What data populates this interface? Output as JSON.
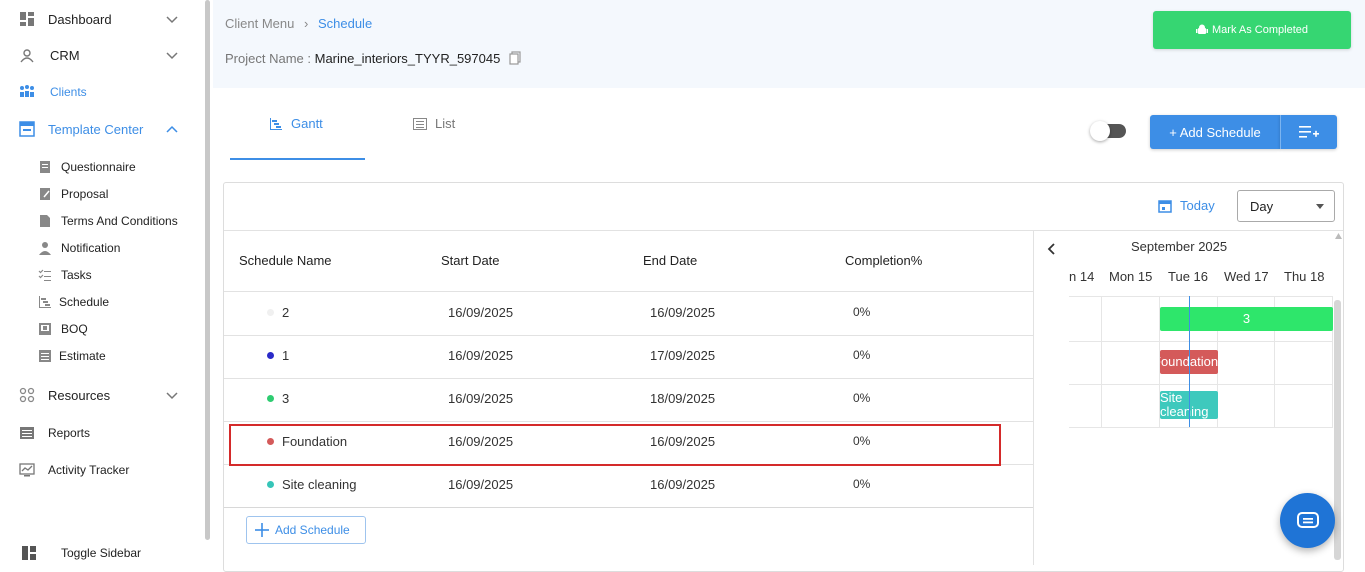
{
  "sidebar": {
    "items": [
      {
        "label": "Dashboard"
      },
      {
        "label": "CRM"
      },
      {
        "label": "Clients"
      },
      {
        "label": "Template Center"
      },
      {
        "label": "Resources"
      },
      {
        "label": "Reports"
      },
      {
        "label": "Activity Tracker"
      }
    ],
    "sub_items": [
      {
        "label": "Questionnaire"
      },
      {
        "label": "Proposal"
      },
      {
        "label": "Terms And Conditions"
      },
      {
        "label": "Notification"
      },
      {
        "label": "Tasks"
      },
      {
        "label": "Schedule"
      },
      {
        "label": "BOQ"
      },
      {
        "label": "Estimate"
      }
    ],
    "toggle_label": "Toggle Sidebar"
  },
  "header": {
    "breadcrumb": {
      "parent": "Client Menu",
      "current": "Schedule"
    },
    "project_label": "Project Name :",
    "project_name": "Marine_interiors_TYYR_597045",
    "mark_completed": "Mark As Completed"
  },
  "tabs": [
    {
      "label": "Gantt"
    },
    {
      "label": "List"
    }
  ],
  "toolbar": {
    "add_schedule": "+ Add Schedule",
    "today": "Today",
    "view_select": "Day"
  },
  "table": {
    "columns": [
      "Schedule Name",
      "Start Date",
      "End Date",
      "Completion%"
    ],
    "rows": [
      {
        "name": "2",
        "start": "16/09/2025",
        "end": "16/09/2025",
        "completion": "0%",
        "color": "#f0f0f0"
      },
      {
        "name": "1",
        "start": "16/09/2025",
        "end": "17/09/2025",
        "completion": "0%",
        "color": "#2a2ac8"
      },
      {
        "name": "3",
        "start": "16/09/2025",
        "end": "18/09/2025",
        "completion": "0%",
        "color": "#2ecc71"
      },
      {
        "name": "Foundation",
        "start": "16/09/2025",
        "end": "16/09/2025",
        "completion": "0%",
        "color": "#d45a5a"
      },
      {
        "name": "Site cleaning",
        "start": "16/09/2025",
        "end": "16/09/2025",
        "completion": "0%",
        "color": "#36c5b8"
      }
    ],
    "add_schedule": "Add Schedule"
  },
  "timeline": {
    "month": "September 2025",
    "days": [
      "n 14",
      "Mon 15",
      "Tue 16",
      "Wed 17",
      "Thu 18"
    ],
    "bars": [
      {
        "label": "3",
        "color": "#2ee66b"
      },
      {
        "label": "Foundation",
        "color": "#d45a5a"
      },
      {
        "label": "Site cleaning",
        "color": "#3ec9bd"
      }
    ]
  }
}
